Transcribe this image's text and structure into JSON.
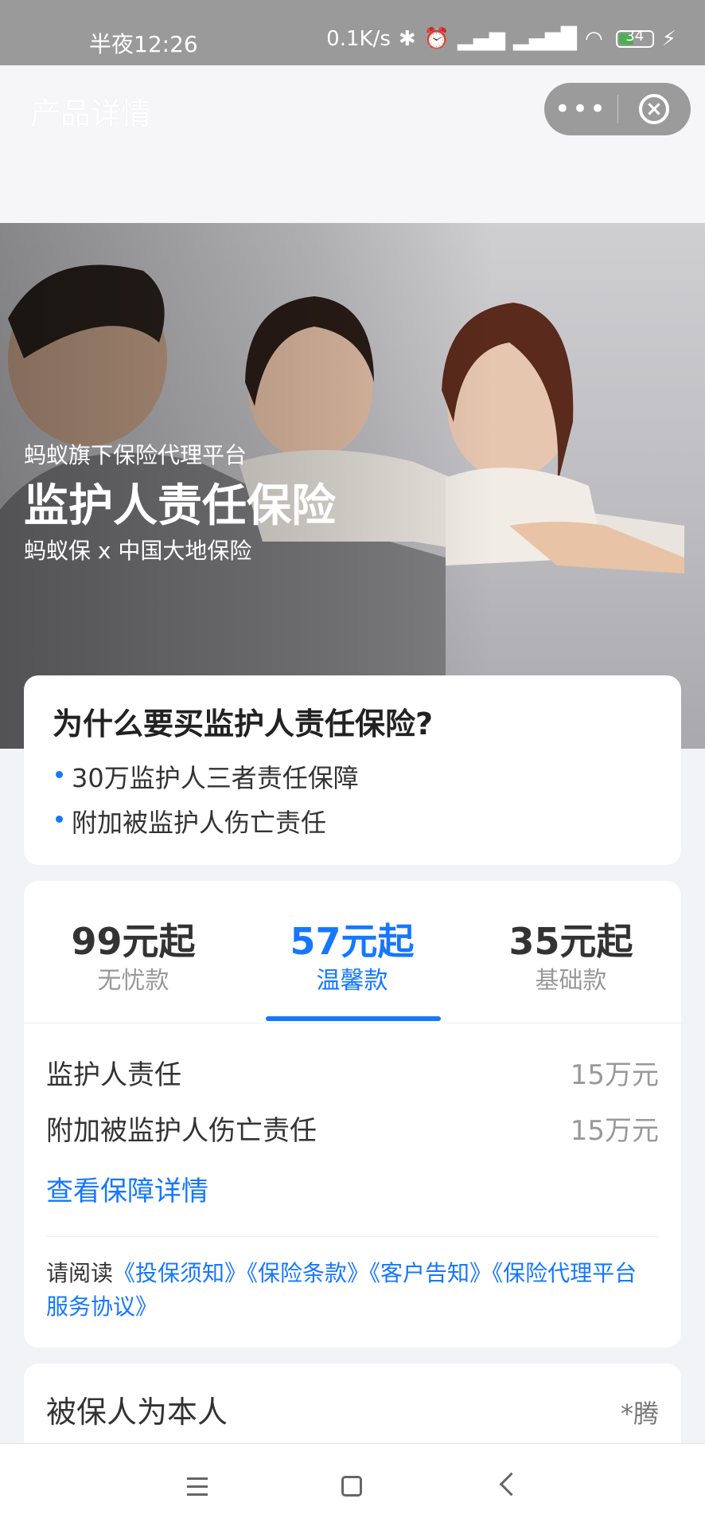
{
  "status_bar": {
    "time": "半夜12:26",
    "net_speed": "0.1K/s",
    "battery": "34",
    "icons": [
      "bluetooth-icon",
      "alarm-icon",
      "hd-signal-icon",
      "signal-icon",
      "wifi-icon",
      "battery-icon",
      "charging-icon"
    ]
  },
  "title_bar": {
    "title": "产品详情",
    "more_label": "•••"
  },
  "hero": {
    "subtitle": "蚂蚁旗下保险代理平台",
    "title": "监护人责任保险",
    "partner": "蚂蚁保 x 中国大地保险"
  },
  "why": {
    "title": "为什么要买监护人责任保险?",
    "items": [
      "30万监护人三者责任保障",
      "附加被监护人伤亡责任"
    ]
  },
  "plans": {
    "tabs": [
      {
        "price": "99元起",
        "name": "无忧款"
      },
      {
        "price": "57元起",
        "name": "温馨款"
      },
      {
        "price": "35元起",
        "name": "基础款"
      }
    ],
    "selected": "温馨款",
    "coverages": [
      {
        "label": "监护人责任",
        "value": "15万元"
      },
      {
        "label": "附加被监护人伤亡责任",
        "value": "15万元"
      }
    ],
    "details_link": "查看保障详情",
    "read_prefix": "请阅读",
    "docs": [
      "《投保须知》",
      "《保险条款》",
      "《客户告知》",
      "《保险代理平台服务协议》"
    ]
  },
  "insured": {
    "label": "被保人为本人",
    "name": "*腾"
  },
  "colors": {
    "accent": "#1677ff",
    "status_bar": "#9a9a9a",
    "page_bg": "#f2f3f7"
  }
}
